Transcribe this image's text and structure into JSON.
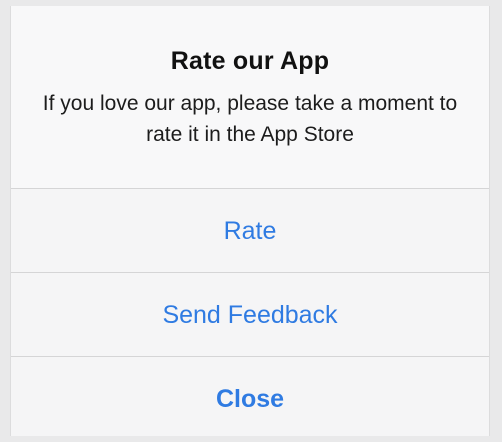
{
  "dialog": {
    "title": "Rate our App",
    "message": "If you love our app, please take a moment to rate it in the App Store",
    "actions": [
      {
        "label": "Rate"
      },
      {
        "label": "Send Feedback"
      },
      {
        "label": "Close"
      }
    ]
  },
  "colors": {
    "accent": "#2f7be2",
    "background": "#f5f5f6",
    "divider": "#d5d5d6"
  }
}
